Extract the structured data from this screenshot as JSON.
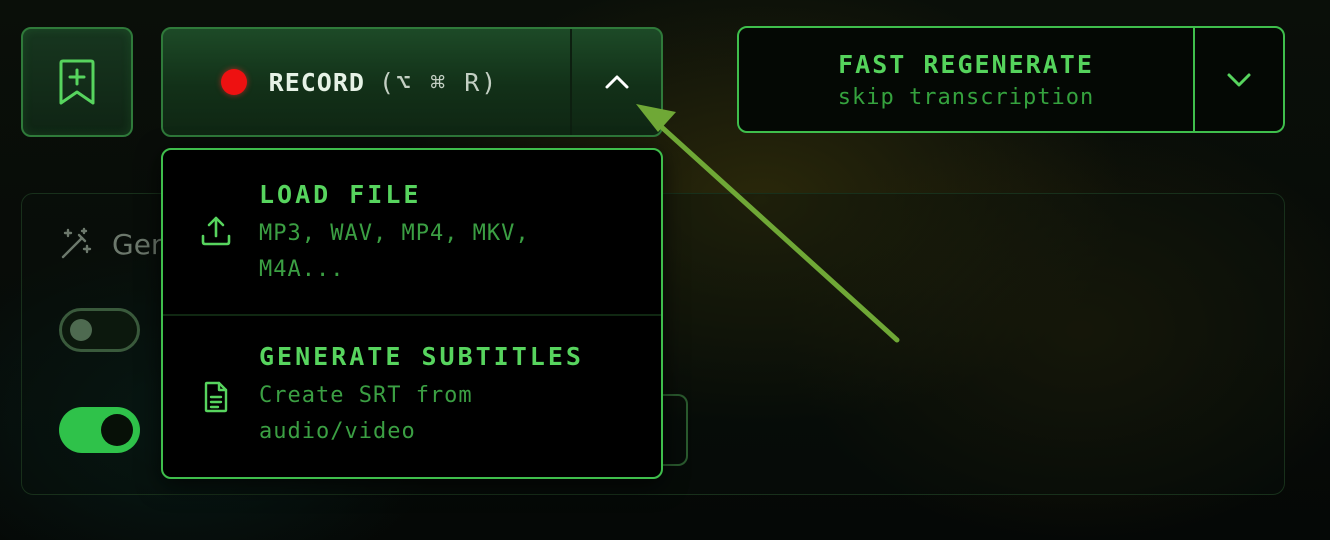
{
  "toolbar": {
    "bookmark_icon": "bookmark-plus-icon",
    "record": {
      "label": "RECORD",
      "shortcut": "(⌥ ⌘ R)",
      "dot_color": "#ee1111",
      "toggle_icon": "chevron-up-icon"
    },
    "fast_regenerate": {
      "title": "FAST REGENERATE",
      "subtitle": "skip transcription",
      "toggle_icon": "chevron-down-icon"
    }
  },
  "menu": {
    "items": [
      {
        "title": "LOAD FILE",
        "description": "MP3, WAV, MP4, MKV,\nM4A...",
        "icon": "upload-icon"
      },
      {
        "title": "GENERATE SUBTITLES",
        "description": "Create SRT from\naudio/video",
        "icon": "document-icon"
      }
    ]
  },
  "panel": {
    "title": "Gen",
    "title_icon": "magic-wand-icon",
    "toggles": [
      {
        "state": "off"
      },
      {
        "state": "on"
      }
    ]
  },
  "colors": {
    "accent": "#3fbe4c",
    "accent_text": "#57d45e",
    "muted_text": "#3b9f43",
    "arrow": "#6fa836"
  }
}
